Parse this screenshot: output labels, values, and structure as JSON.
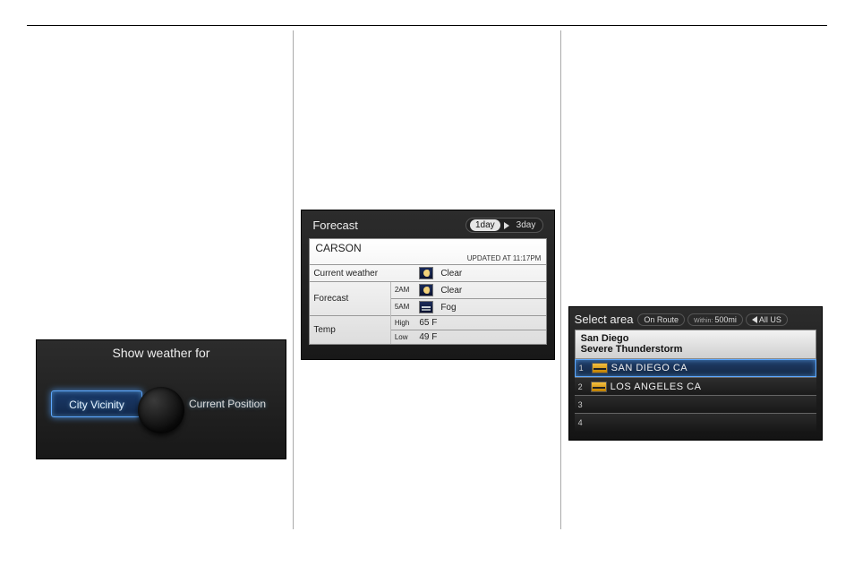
{
  "panel1": {
    "title": "Show weather for",
    "city_vicinity": "City Vicinity",
    "current_position": "Current Position"
  },
  "panel2": {
    "header": "Forecast",
    "tab_1day": "1day",
    "tab_3day": "3day",
    "city": "CARSON",
    "updated": "UPDATED AT  11:17PM",
    "rows": {
      "current_label": "Current weather",
      "current_value": "Clear",
      "forecast_label": "Forecast",
      "forecast_t1": "2AM",
      "forecast_v1": "Clear",
      "forecast_t2": "5AM",
      "forecast_v2": "Fog",
      "temp_label": "Temp",
      "temp_high_label": "High",
      "temp_high": "65 F",
      "temp_low_label": "Low",
      "temp_low": "49 F"
    }
  },
  "panel3": {
    "title": "Select area",
    "chip_onroute": "On Route",
    "chip_within_label": "Within:",
    "chip_within_value": "500mi",
    "chip_allus": "All US",
    "detail_city": "San Diego",
    "detail_alert": "Severe Thunderstorm",
    "items": [
      {
        "n": "1",
        "label": "SAN DIEGO CA"
      },
      {
        "n": "2",
        "label": "LOS ANGELES CA"
      },
      {
        "n": "3",
        "label": ""
      },
      {
        "n": "4",
        "label": ""
      }
    ]
  }
}
